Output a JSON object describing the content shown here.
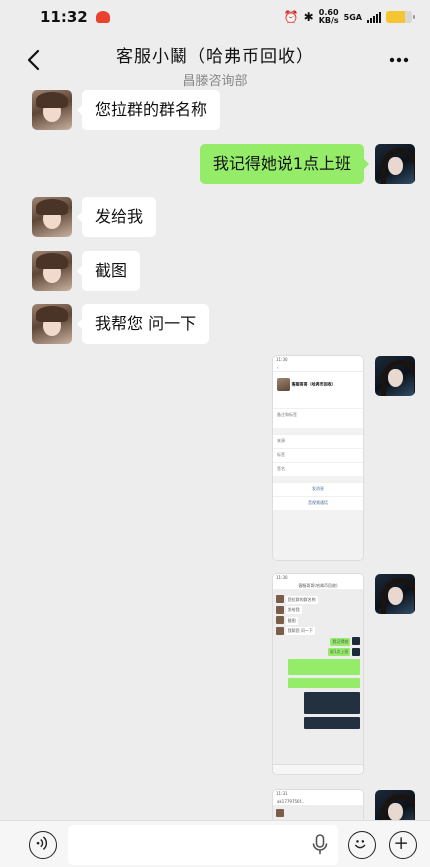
{
  "status_bar": {
    "time": "11:32",
    "net_speed_value": "0.60",
    "net_speed_unit": "KB/s",
    "network": "5GA",
    "battery_level": 0.75
  },
  "header": {
    "title": "客服小鬫（哈弗币回收）",
    "subtitle": "昌滕咨询部"
  },
  "messages": [
    {
      "side": "in",
      "text": "您拉群的群名称"
    },
    {
      "side": "out",
      "text": "我记得她说1点上班"
    },
    {
      "side": "in",
      "text": "发给我"
    },
    {
      "side": "in",
      "text": "截图"
    },
    {
      "side": "in",
      "text": "我帮您 问一下"
    },
    {
      "side": "out",
      "type": "image",
      "content": "screenshot-contact-card"
    },
    {
      "side": "out",
      "type": "image",
      "content": "screenshot-chat"
    },
    {
      "side": "out",
      "type": "image",
      "content": "screenshot-chat-2"
    }
  ],
  "thumb1": {
    "time": "11:30",
    "name": "客服哥哥（哈弗币回收）",
    "rows": [
      "备注和标签",
      "朋友权限",
      "更多信息"
    ],
    "group_rows": [
      "来源",
      "标签",
      "签名"
    ],
    "actions": [
      "发消息",
      "音视频通话"
    ]
  },
  "thumb2": {
    "time": "11:30",
    "title": "客服哥哥(哈弗币回收)",
    "lines_in": [
      "您拉群的群名称",
      "发给我",
      "截图",
      "我帮您 问一下"
    ],
    "lines_out": [
      "我记得她",
      "说1点上班"
    ]
  },
  "thumb3": {
    "time": "11:31",
    "title": "ak1779756f..."
  },
  "icons": {
    "back": "chevron-left-icon",
    "more": "more-dots-icon",
    "voice": "voice-mode-icon",
    "mic": "microphone-icon",
    "emoji": "emoji-icon",
    "plus": "plus-icon"
  },
  "colors": {
    "background": "#ededed",
    "outgoing_bubble": "#95ec69",
    "incoming_bubble": "#ffffff"
  }
}
